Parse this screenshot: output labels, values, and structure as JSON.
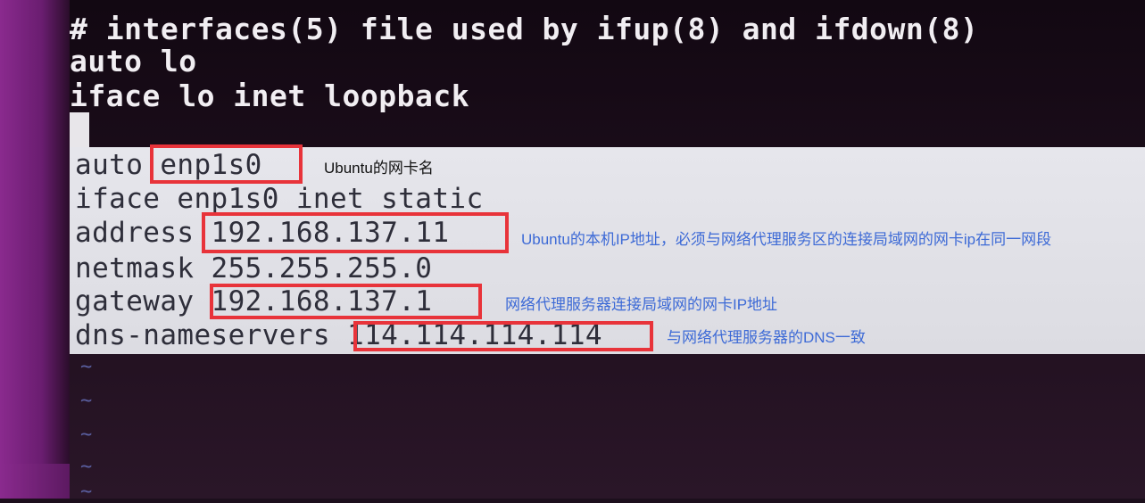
{
  "terminal": {
    "header_lines": [
      "# interfaces(5) file used by ifup(8) and ifdown(8)",
      "auto lo",
      "iface lo inet loopback"
    ],
    "config": {
      "auto_keyword": "auto",
      "auto_value": "enp1s0",
      "iface_line": "iface enp1s0 inet static",
      "address_key": "address",
      "address_value": "192.168.137.11",
      "netmask_line": "netmask 255.255.255.0",
      "gateway_key": "gateway",
      "gateway_value": "192.168.137.1",
      "dns_key": "dns-nameservers",
      "dns_value": "114.114.114.114"
    },
    "empty_line_marker": "~"
  },
  "annotations": {
    "nic_name": "Ubuntu的网卡名",
    "local_ip": "Ubuntu的本机IP地址，必须与网络代理服务区的连接局域网的网卡ip在同一网段",
    "gateway": "网络代理服务器连接局域网的网卡IP地址",
    "dns": "与网络代理服务器的DNS一致"
  },
  "colors": {
    "highlight_box": "#e8333a",
    "annotation_blue": "#3d6ad6",
    "annotation_black": "#111111"
  }
}
